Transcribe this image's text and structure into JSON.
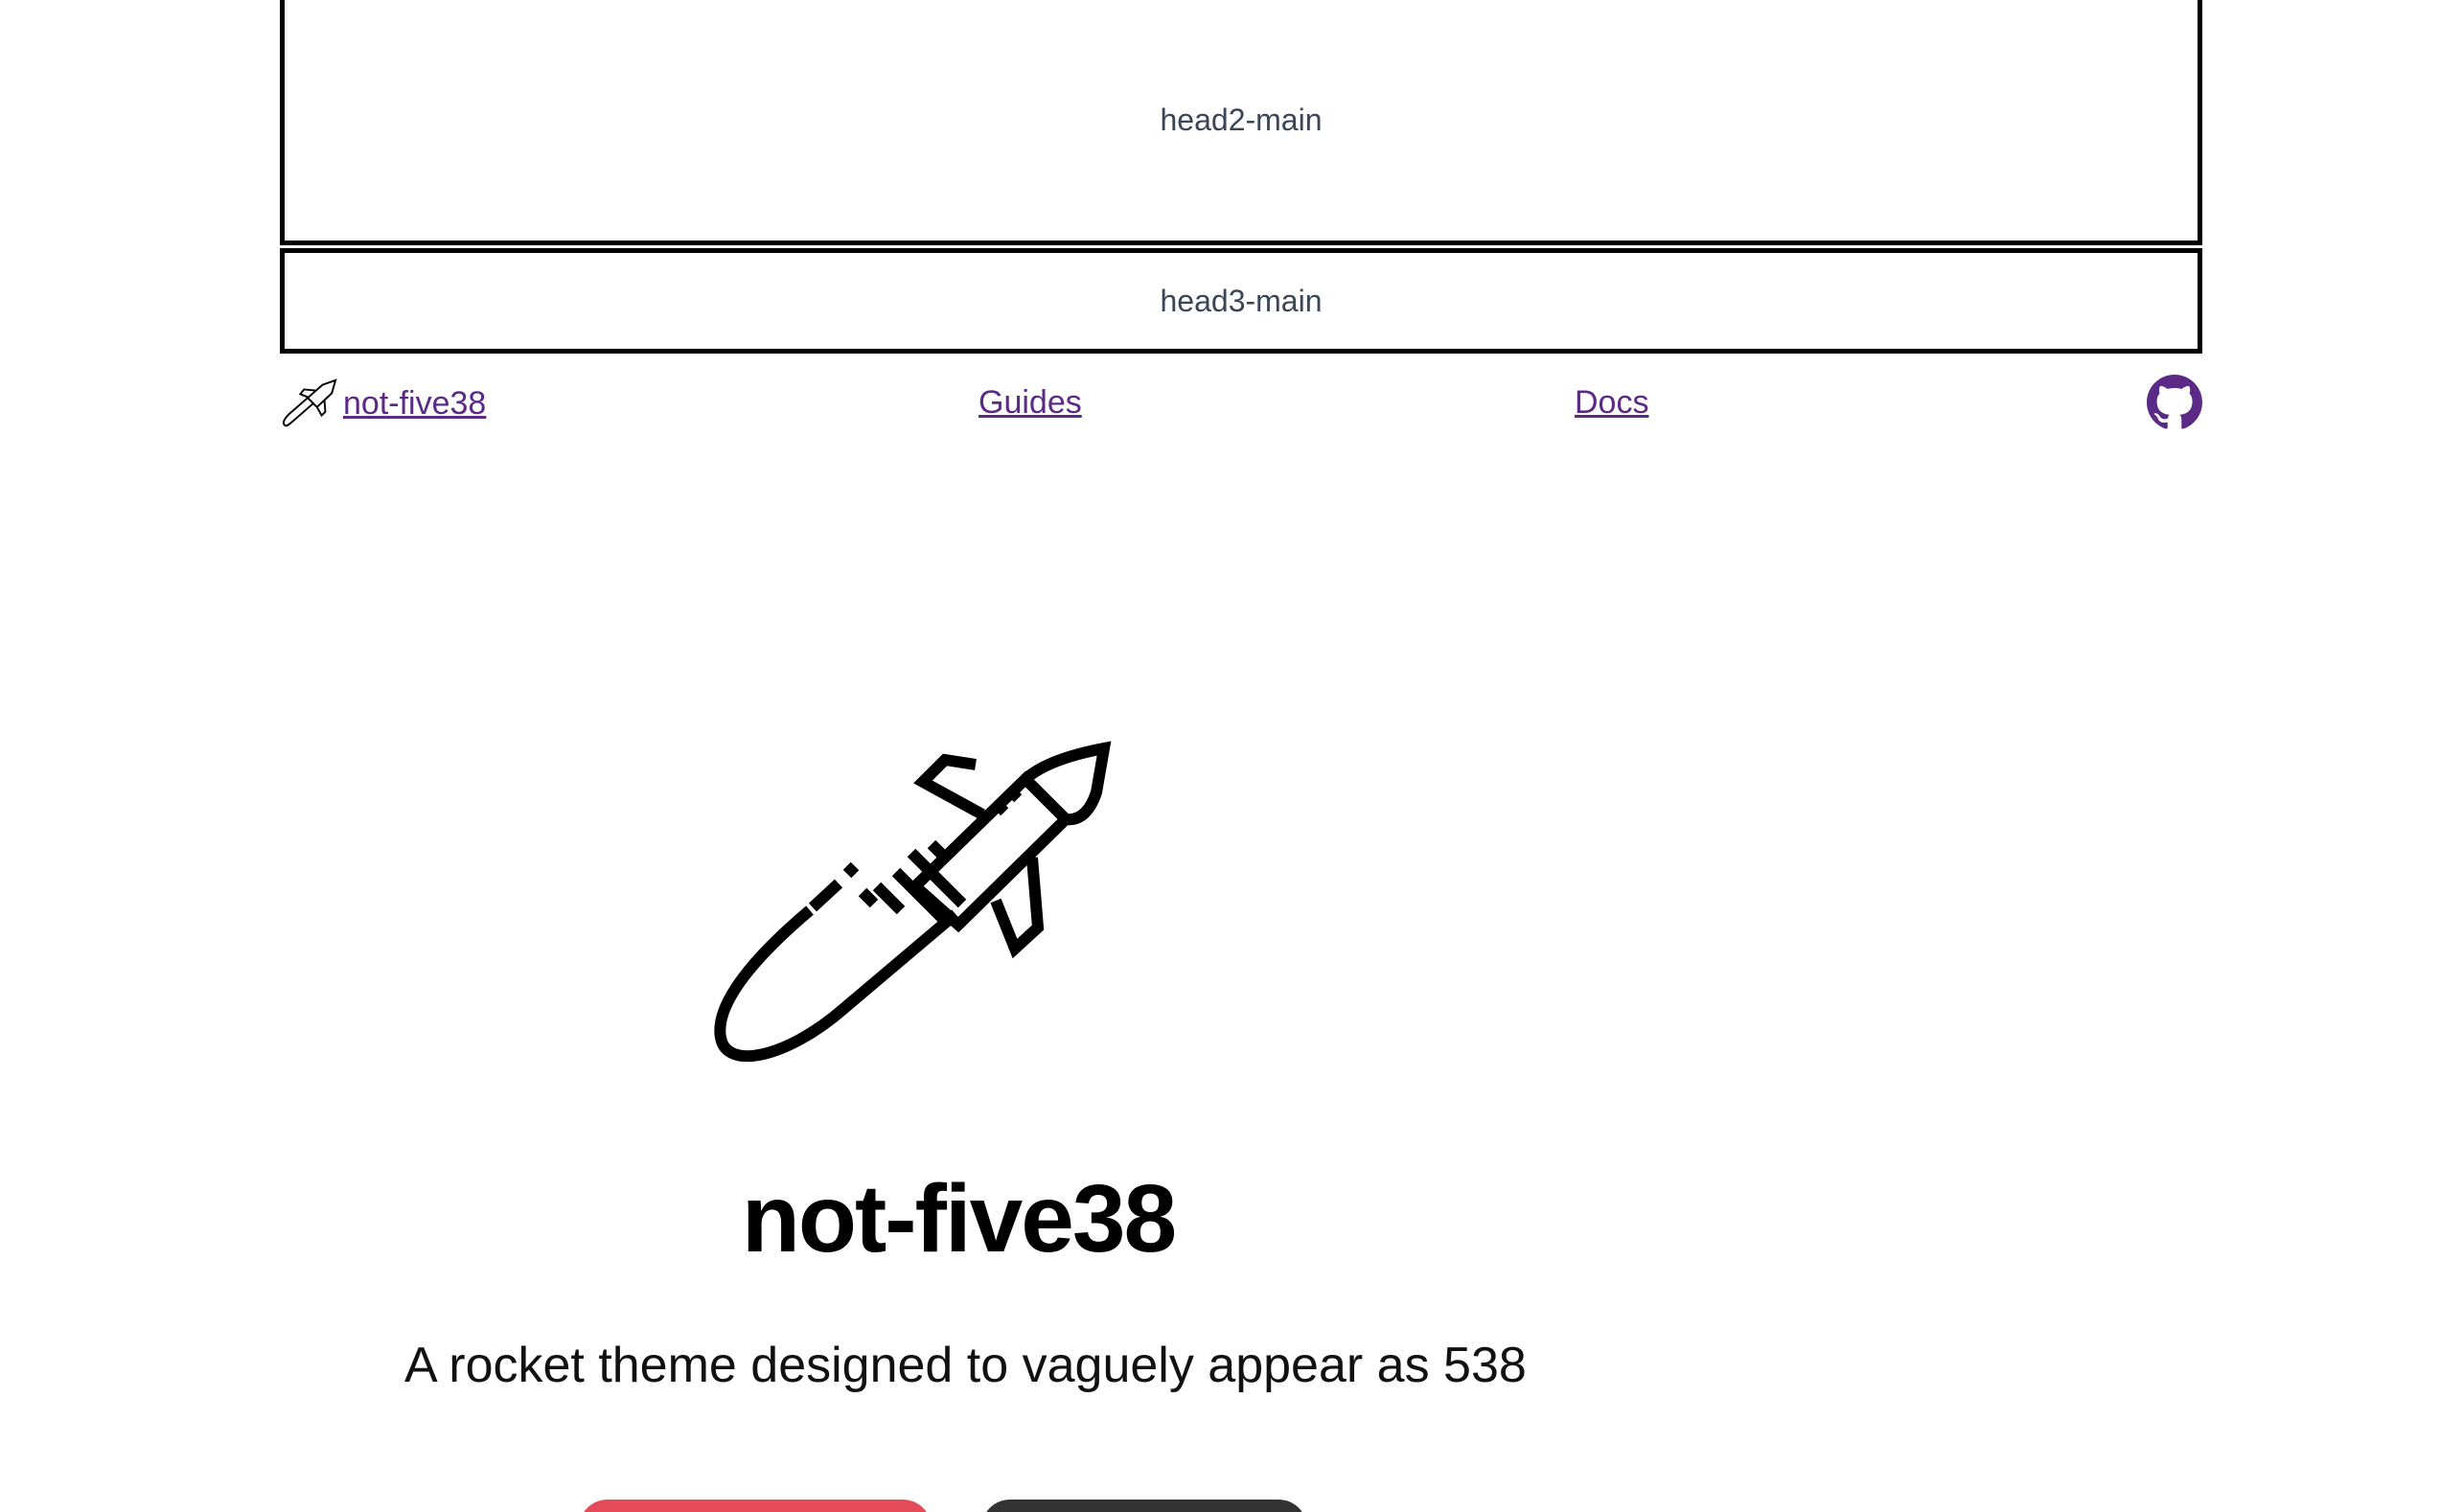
{
  "headers": {
    "head2": "head2-main",
    "head3": "head3-main"
  },
  "nav": {
    "brand": "not-five38",
    "guides": "Guides",
    "docs": "Docs",
    "github_icon": "github-icon"
  },
  "hero": {
    "title": "not-five38",
    "subtitle": "A rocket theme designed to vaguely appear as 538"
  },
  "colors": {
    "link": "#5b2a86",
    "primary_button": "#e44a57",
    "secondary_button": "#333333"
  }
}
